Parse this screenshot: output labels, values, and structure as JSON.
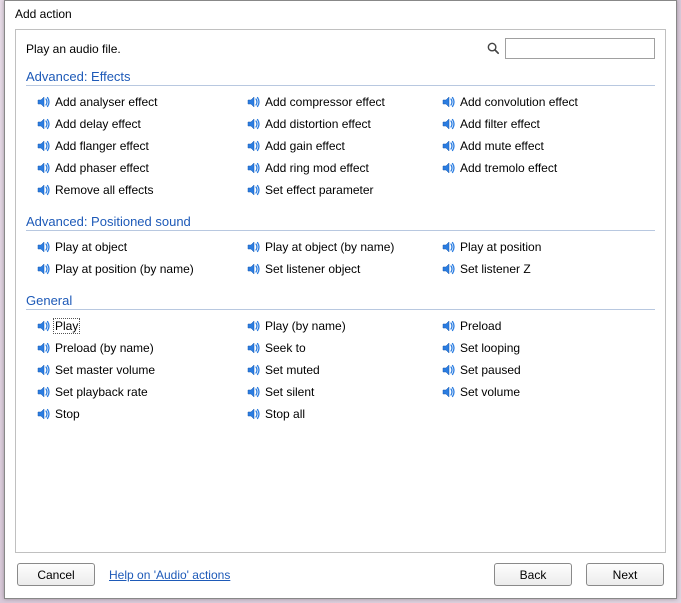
{
  "window": {
    "title": "Add action"
  },
  "description": "Play an audio file.",
  "search": {
    "placeholder": "",
    "value": ""
  },
  "groups": [
    {
      "title": "Advanced: Effects",
      "items": [
        "Add analyser effect",
        "Add compressor effect",
        "Add convolution effect",
        "Add delay effect",
        "Add distortion effect",
        "Add filter effect",
        "Add flanger effect",
        "Add gain effect",
        "Add mute effect",
        "Add phaser effect",
        "Add ring mod effect",
        "Add tremolo effect",
        "Remove all effects",
        "Set effect parameter"
      ]
    },
    {
      "title": "Advanced: Positioned sound",
      "items": [
        "Play at object",
        "Play at object (by name)",
        "Play at position",
        "Play at position (by name)",
        "Set listener object",
        "Set listener Z"
      ]
    },
    {
      "title": "General",
      "items": [
        "Play",
        "Play (by name)",
        "Preload",
        "Preload (by name)",
        "Seek to",
        "Set looping",
        "Set master volume",
        "Set muted",
        "Set paused",
        "Set playback rate",
        "Set silent",
        "Set volume",
        "Stop",
        "Stop all"
      ],
      "selected": 0
    }
  ],
  "footer": {
    "cancel": "Cancel",
    "help": "Help on 'Audio' actions",
    "back": "Back",
    "next": "Next"
  }
}
